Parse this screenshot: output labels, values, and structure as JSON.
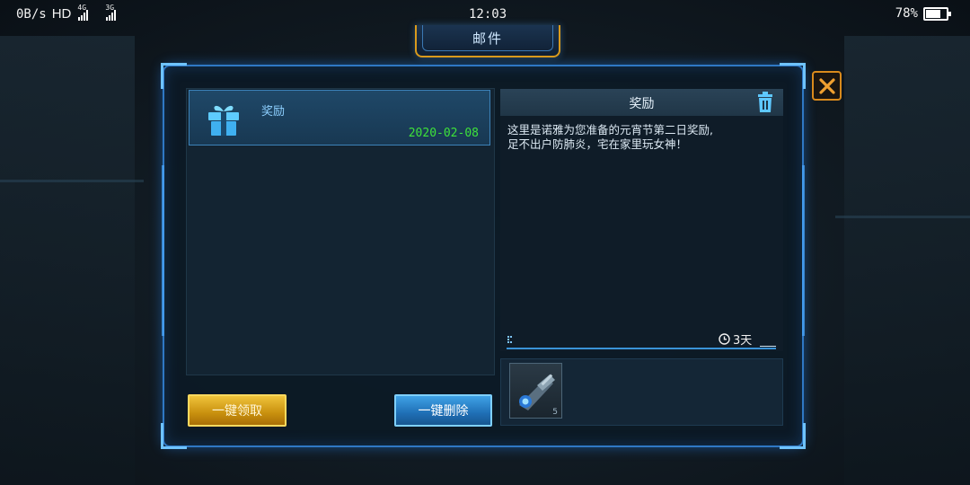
{
  "status_bar": {
    "speed": "0B/s",
    "hd": "HD",
    "net1": "4G",
    "net2": "3G",
    "time": "12:03",
    "battery": "78%",
    "battery_level": 0.78
  },
  "window": {
    "title": "邮件"
  },
  "mail_list": [
    {
      "subject": "奖励",
      "date": "2020-02-08",
      "icon": "gift-icon",
      "selected": true
    }
  ],
  "detail": {
    "title": "奖励",
    "body": "这里是诺雅为您准备的元宵节第二日奖励,\n足不出户防肺炎，宅在家里玩女神！",
    "expire": "3天",
    "attachments": [
      {
        "icon": "weapon-cannon-icon",
        "quantity": "5"
      }
    ]
  },
  "buttons": {
    "claim_all": "一键领取",
    "delete_all": "一键删除"
  },
  "colors": {
    "frame": "#2f78c4",
    "accent_gold": "#d99a1c",
    "date_green": "#3ee33a"
  }
}
